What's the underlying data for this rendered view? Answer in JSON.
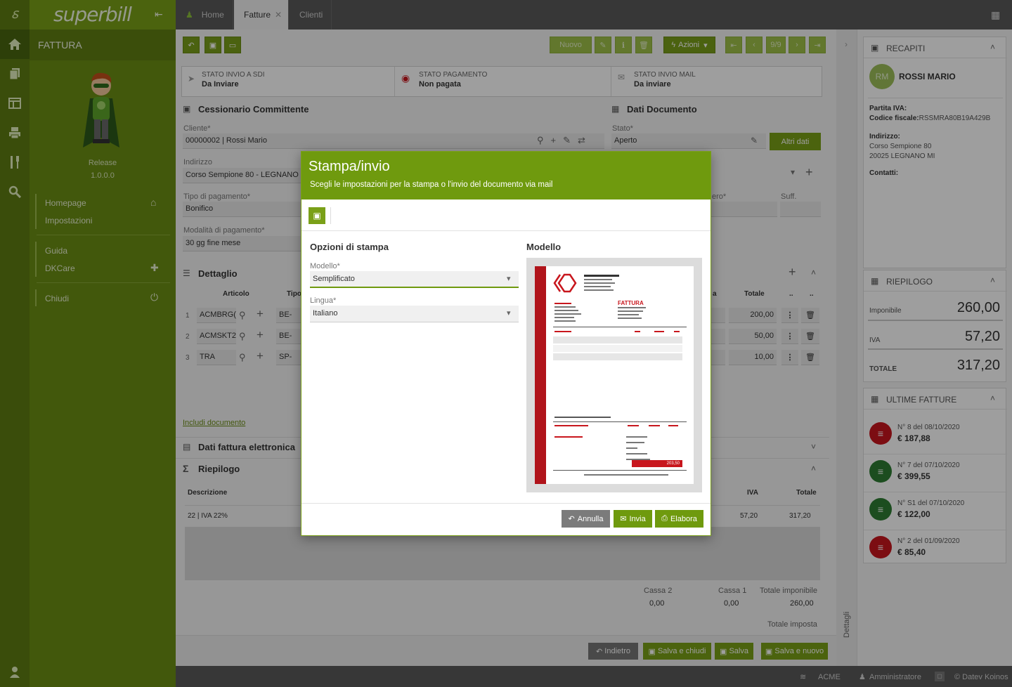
{
  "app": {
    "brand": "superbill",
    "section": "FATTURA",
    "release_label": "Release",
    "release_version": "1.0.0.0"
  },
  "sidebar": {
    "links": [
      {
        "label": "Homepage"
      },
      {
        "label": "Impostazioni"
      },
      {
        "label": "Guida"
      },
      {
        "label": "DKCare"
      },
      {
        "label": "Chiudi"
      }
    ]
  },
  "tabs": [
    {
      "label": "Home"
    },
    {
      "label": "Fatture"
    },
    {
      "label": "Clienti"
    }
  ],
  "toolbar": {
    "nuovo": "Nuovo",
    "azioni": "Azioni",
    "pager": "9/9"
  },
  "status": {
    "sdi_title": "STATO INVIO A SDI",
    "sdi_value": "Da Inviare",
    "pay_title": "STATO PAGAMENTO",
    "pay_value": "Non pagata",
    "mail_title": "STATO INVIO MAIL",
    "mail_value": "Da inviare"
  },
  "form": {
    "cessionario_title": "Cessionario Committente",
    "cliente_label": "Cliente*",
    "cliente_value": "00000002 | Rossi Mario",
    "indirizzo_label": "Indirizzo",
    "indirizzo_value": "Corso Sempione 80 - LEGNANO",
    "tipo_pag_label": "Tipo di pagamento*",
    "tipo_pag_value": "Bonifico",
    "mod_pag_label": "Modalità di pagamento*",
    "mod_pag_value": "30 gg fine mese",
    "dati_doc_title": "Dati Documento",
    "stato_label": "Stato*",
    "stato_value": "Aperto",
    "altri_dati": "Altri dati",
    "numero_label_tail": "ero*",
    "suff_label": "Suff."
  },
  "detail": {
    "title": "Dettaglio",
    "col_articolo": "Articolo",
    "col_tipo": "Tipo",
    "col_iva_tail": "a",
    "col_totale": "Totale",
    "col_dots": "..",
    "rows": [
      {
        "n": "1",
        "articolo": "ACMBRG(",
        "tipo": "BE-",
        "totale": "200,00"
      },
      {
        "n": "2",
        "articolo": "ACMSKT2",
        "tipo": "BE-",
        "totale": "50,00"
      },
      {
        "n": "3",
        "articolo": "TRA",
        "tipo": "SP-",
        "totale": "10,00"
      }
    ],
    "include_link": "Includi documento"
  },
  "dati_fe_title": "Dati fattura elettronica",
  "riepilogo": {
    "title": "Riepilogo",
    "col_desc": "Descrizione",
    "col_iva": "IVA",
    "col_totale": "Totale",
    "row_desc": "22 | IVA 22%",
    "row_iva": "57,20",
    "row_totale": "317,20",
    "cassa2_label": "Cassa 2",
    "cassa2_value": "0,00",
    "cassa1_label": "Cassa 1",
    "cassa1_value": "0,00",
    "tot_imp_label": "Totale imponibile",
    "tot_imp_value": "260,00",
    "tot_imposta_label": "Totale imposta"
  },
  "bottom_buttons": {
    "indietro": "Indietro",
    "salva_chiudi": "Salva e chiudi",
    "salva": "Salva",
    "salva_nuovo": "Salva e nuovo"
  },
  "right": {
    "dettagli_label": "Dettagli",
    "recapiti_title": "RECAPITI",
    "avatar_initials": "RM",
    "customer_name": "ROSSI MARIO",
    "piva_label": "Partita IVA:",
    "cf_label": "Codice fiscale:",
    "cf_value": "RSSMRA80B19A429B",
    "indirizzo_label": "Indirizzo:",
    "indirizzo_1": "Corso Sempione 80",
    "indirizzo_2": "20025 LEGNANO MI",
    "contatti_label": "Contatti:",
    "riepilogo_title": "RIEPILOGO",
    "imponibile_label": "Imponibile",
    "imponibile_value": "260,00",
    "iva_label": "IVA",
    "iva_value": "57,20",
    "totale_label": "TOTALE",
    "totale_value": "317,20",
    "ultime_title": "ULTIME FATTURE",
    "invoices": [
      {
        "title": "N° 8 del 08/10/2020",
        "amount": "€ 187,88",
        "color": "#c8161d"
      },
      {
        "title": "N° 7 del 07/10/2020",
        "amount": "€ 399,55",
        "color": "#2e7d32"
      },
      {
        "title": "N° S1 del 07/10/2020",
        "amount": "€ 122,00",
        "color": "#2e7d32"
      },
      {
        "title": "N° 2 del 01/09/2020",
        "amount": "€ 85,40",
        "color": "#c8161d"
      }
    ]
  },
  "footer": {
    "company": "ACME",
    "user": "Amministratore",
    "copyright": "© Datev Koinos"
  },
  "modal": {
    "title": "Stampa/invio",
    "subtitle": "Scegli le impostazioni per la stampa o l'invio del documento via mail",
    "options_title": "Opzioni di stampa",
    "modello_label": "Modello*",
    "modello_value": "Semplificato",
    "lingua_label": "Lingua*",
    "lingua_value": "Italiano",
    "preview_title": "Modello",
    "preview_doc_title": "FATTURA",
    "preview_total": "203,50",
    "annulla": "Annulla",
    "invia": "Invia",
    "elabora": "Elabora"
  },
  "colors": {
    "brand_green": "#7aa018",
    "dark_green": "#5e7d12",
    "accent_red": "#c8161d"
  }
}
